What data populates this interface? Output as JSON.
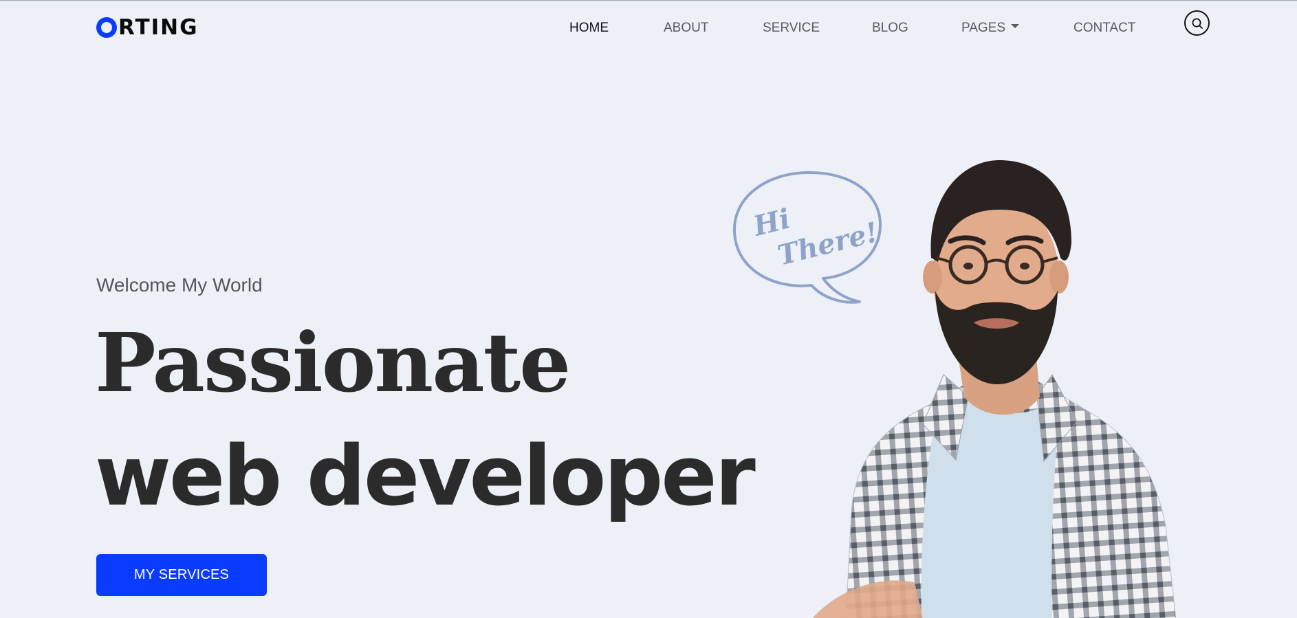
{
  "brand": {
    "logo_text": "RTING",
    "accent": "#0a3cff"
  },
  "nav": {
    "items": [
      {
        "label": "HOME",
        "active": true
      },
      {
        "label": "ABOUT",
        "active": false
      },
      {
        "label": "SERVICE",
        "active": false
      },
      {
        "label": "BLOG",
        "active": false
      },
      {
        "label": "PAGES",
        "active": false,
        "dropdown": true
      },
      {
        "label": "CONTACT",
        "active": false
      }
    ],
    "search_icon": "search-icon"
  },
  "hero": {
    "welcome": "Welcome My World",
    "headline_line1": "Passionate",
    "headline_line2": "web developer",
    "cta_label": "MY SERVICES",
    "bubble_line1": "Hi",
    "bubble_line2": "There!",
    "bubble_color": "#8fa3c8"
  },
  "colors": {
    "background": "#edf1f7",
    "heading": "#2b2b2b",
    "nav_text": "#5a5a5a"
  }
}
